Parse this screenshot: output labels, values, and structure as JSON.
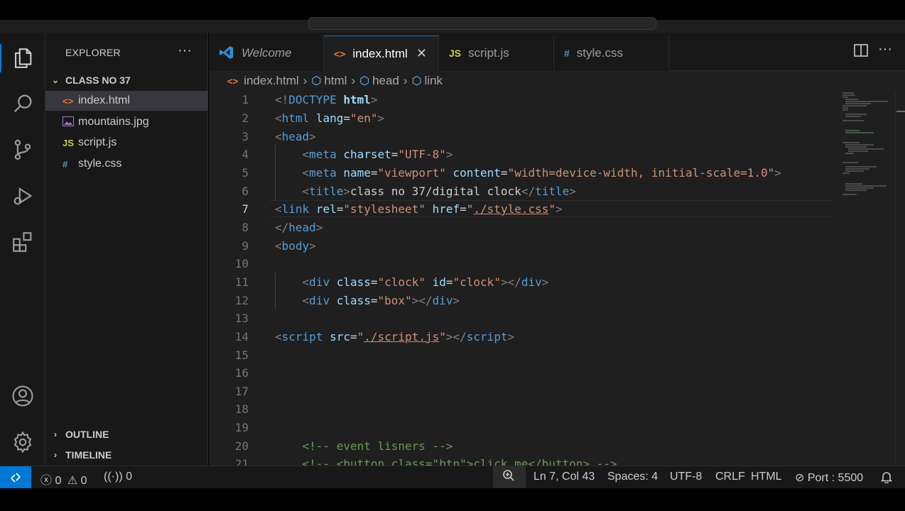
{
  "explorer": {
    "title": "EXPLORER",
    "more": "···",
    "folder": "CLASS NO 37",
    "files": [
      {
        "name": "index.html",
        "icon": "<>",
        "type": "html"
      },
      {
        "name": "mountains.jpg",
        "icon": "image-icon",
        "type": "image"
      },
      {
        "name": "script.js",
        "icon": "JS",
        "type": "js"
      },
      {
        "name": "style.css",
        "icon": "#",
        "type": "css"
      }
    ],
    "outline": "OUTLINE",
    "timeline": "TIMELINE"
  },
  "tabs": [
    {
      "label": "Welcome",
      "icon": "vscode-icon"
    },
    {
      "label": "index.html",
      "icon": "<>",
      "active": true,
      "close": "✕"
    },
    {
      "label": "script.js",
      "icon": "JS"
    },
    {
      "label": "style.css",
      "icon": "#"
    }
  ],
  "breadcrumb": [
    "index.html",
    "html",
    "head",
    "link"
  ],
  "editor": {
    "line_numbers": [
      "1",
      "2",
      "3",
      "4",
      "5",
      "6",
      "7",
      "8",
      "9",
      "10",
      "11",
      "12",
      "13",
      "14",
      "15",
      "16",
      "17",
      "18",
      "19",
      "20",
      "21"
    ],
    "current_line": "7",
    "code": {
      "l1_open": "<!",
      "l1_tag": "DOCTYPE",
      "l1_attr": " html",
      "l1_close": ">",
      "l2_tag": "html",
      "l2_attr": "lang",
      "l2_val": "\"en\"",
      "l3_tag": "head",
      "l4_tag": "meta",
      "l4_attr": "charset",
      "l4_val": "\"UTF-8\"",
      "l5_tag": "meta",
      "l5_attr1": "name",
      "l5_val1": "\"viewport\"",
      "l5_attr2": "content",
      "l5_val2": "\"width=device-width, initial-scale=1.0\"",
      "l6_tag": "title",
      "l6_text": "class no 37/digital clock",
      "l6_endtag": "title",
      "l7_tag": "link",
      "l7_attr1": "rel",
      "l7_val1": "\"stylesheet\"",
      "l7_attr2": "href",
      "l7_val2_q1": "\"",
      "l7_val2_path": "./style.css",
      "l7_val2_q2": "\"",
      "l8_tag": "head",
      "l9_tag": "body",
      "l11_tag": "div",
      "l11_attr1": "class",
      "l11_val1": "\"clock\"",
      "l11_attr2": "id",
      "l11_val2": "\"clock\"",
      "l11_endtag": "div",
      "l12_tag": "div",
      "l12_attr": "class",
      "l12_val": "\"box\"",
      "l12_endtag": "div",
      "l14_tag": "script",
      "l14_attr": "src",
      "l14_val_q1": "\"",
      "l14_val_path": "./script.js",
      "l14_val_q2": "\"",
      "l14_endtag": "script",
      "l20_comment": "<!-- event lisners -->",
      "l21_comment": "<!-- <button class=\"btn\">click me</button> -->"
    }
  },
  "statusbar": {
    "remote_icon": "remote-icon",
    "errors": "0",
    "warnings": "0",
    "ports": "0",
    "cursor": "Ln 7, Col 43",
    "spaces": "Spaces: 4",
    "encoding": "UTF-8",
    "eol": "CRLF",
    "language": "HTML",
    "port": "Port : 5500"
  },
  "colors": {
    "accent": "#0078d4",
    "editor_bg": "#1f1f1f",
    "sidebar_bg": "#181818",
    "tag": "#569cd6",
    "attribute": "#9cdcfe",
    "string": "#ce9178",
    "comment": "#6a9955"
  }
}
